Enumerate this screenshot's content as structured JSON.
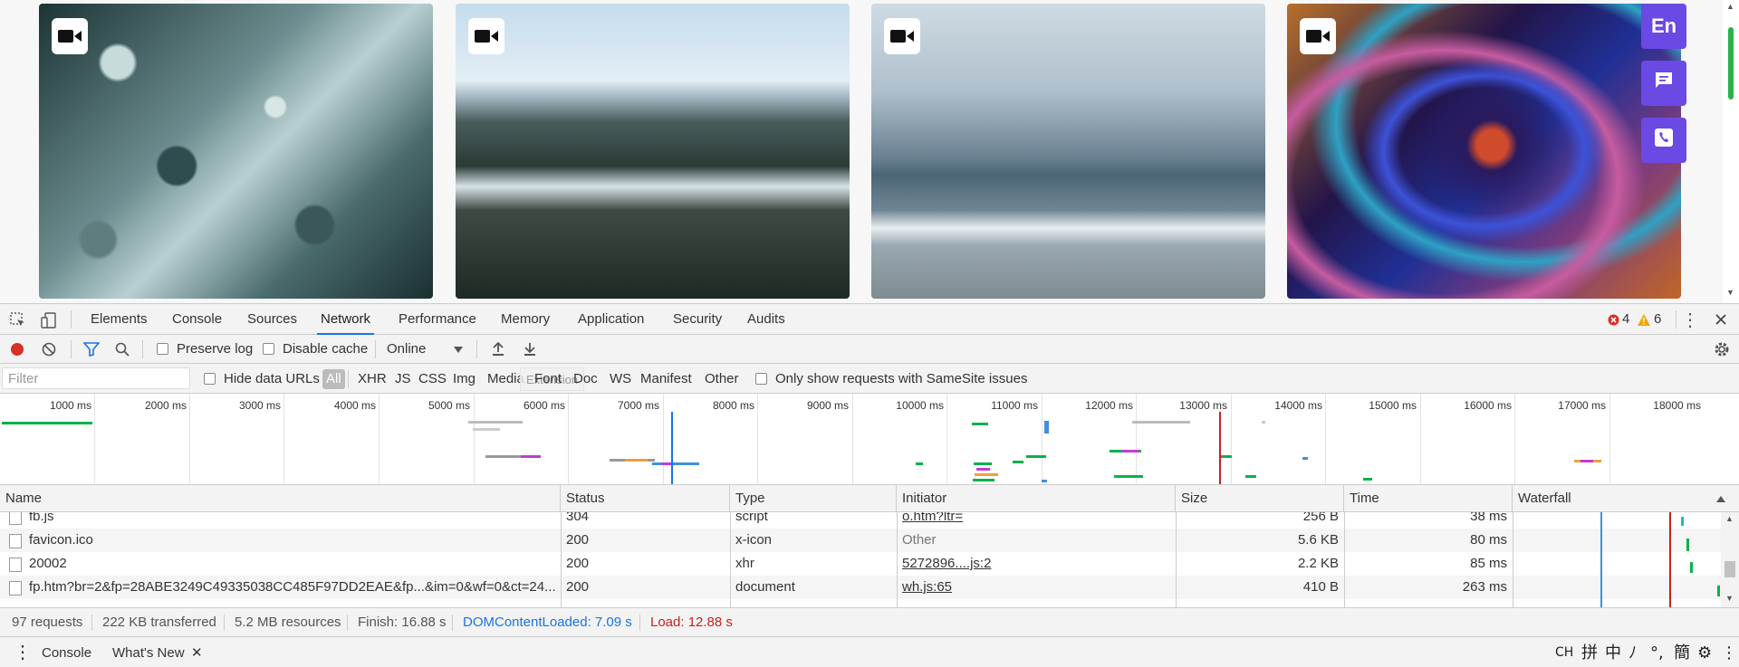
{
  "gallery": {
    "tiles": [
      {
        "badge_icon": "video-camera-icon",
        "scene": "water-droplets"
      },
      {
        "badge_icon": "video-camera-icon",
        "scene": "snowy-valley"
      },
      {
        "badge_icon": "video-camera-icon",
        "scene": "ocean-shore"
      },
      {
        "badge_icon": "video-camera-icon",
        "scene": "fractal-art"
      }
    ],
    "side_buttons": [
      {
        "label": "En",
        "icon": "language-icon"
      },
      {
        "label": "",
        "icon": "chat-icon"
      },
      {
        "label": "",
        "icon": "phone-icon"
      }
    ],
    "accent_color": "#6a49e5"
  },
  "devtools": {
    "tabs": [
      "Elements",
      "Console",
      "Sources",
      "Network",
      "Performance",
      "Memory",
      "Application",
      "Security",
      "Audits"
    ],
    "active_tab": "Network",
    "errors": "4",
    "warnings": "6",
    "toolbar": {
      "preserve_log": "Preserve log",
      "disable_cache": "Disable cache",
      "throttle": "Online"
    },
    "filter": {
      "placeholder": "Filter",
      "hide_data_urls": "Hide data URLs",
      "types": [
        "All",
        "XHR",
        "JS",
        "CSS",
        "Img",
        "Media",
        "Font",
        "Doc",
        "WS",
        "Manifest",
        "Other"
      ],
      "tooltip": "Extension",
      "samesite": "Only show requests with SameSite issues"
    },
    "overview": {
      "ticks": [
        "1000 ms",
        "2000 ms",
        "3000 ms",
        "4000 ms",
        "5000 ms",
        "6000 ms",
        "7000 ms",
        "8000 ms",
        "9000 ms",
        "10000 ms",
        "11000 ms",
        "12000 ms",
        "13000 ms",
        "14000 ms",
        "15000 ms",
        "16000 ms",
        "17000 ms",
        "18000 ms"
      ],
      "domcontentloaded_ms": 7090,
      "load_ms": 12880
    },
    "columns": [
      "Name",
      "Status",
      "Type",
      "Initiator",
      "Size",
      "Time",
      "Waterfall"
    ],
    "rows": [
      {
        "name": "fb.js",
        "status": "304",
        "type": "script",
        "initiator": "o.htm?ltr=",
        "initiator_link": true,
        "size": "256 B",
        "time": "38 ms"
      },
      {
        "name": "favicon.ico",
        "status": "200",
        "type": "x-icon",
        "initiator": "Other",
        "initiator_link": false,
        "size": "5.6 KB",
        "time": "80 ms"
      },
      {
        "name": "20002",
        "status": "200",
        "type": "xhr",
        "initiator": "5272896....js:2",
        "initiator_link": true,
        "size": "2.2 KB",
        "time": "85 ms"
      },
      {
        "name": "fp.htm?br=2&fp=28ABE3249C49335038CC485F97DD2EAE&fp...&im=0&wf=0&ct=24...",
        "status": "200",
        "type": "document",
        "initiator": "wh.js:65",
        "initiator_link": true,
        "size": "410 B",
        "time": "263 ms"
      }
    ],
    "summary": {
      "requests": "97 requests",
      "transferred": "222 KB transferred",
      "resources": "5.2 MB resources",
      "finish": "Finish: 16.88 s",
      "domcontentloaded": "DOMContentLoaded: 7.09 s",
      "load": "Load: 12.88 s"
    },
    "drawer": {
      "tabs": [
        "Console",
        "What's New"
      ],
      "ime": [
        "CH",
        "拼",
        "中",
        "ﾉ",
        "°,",
        "簡",
        "⚙",
        "⋮"
      ]
    }
  }
}
